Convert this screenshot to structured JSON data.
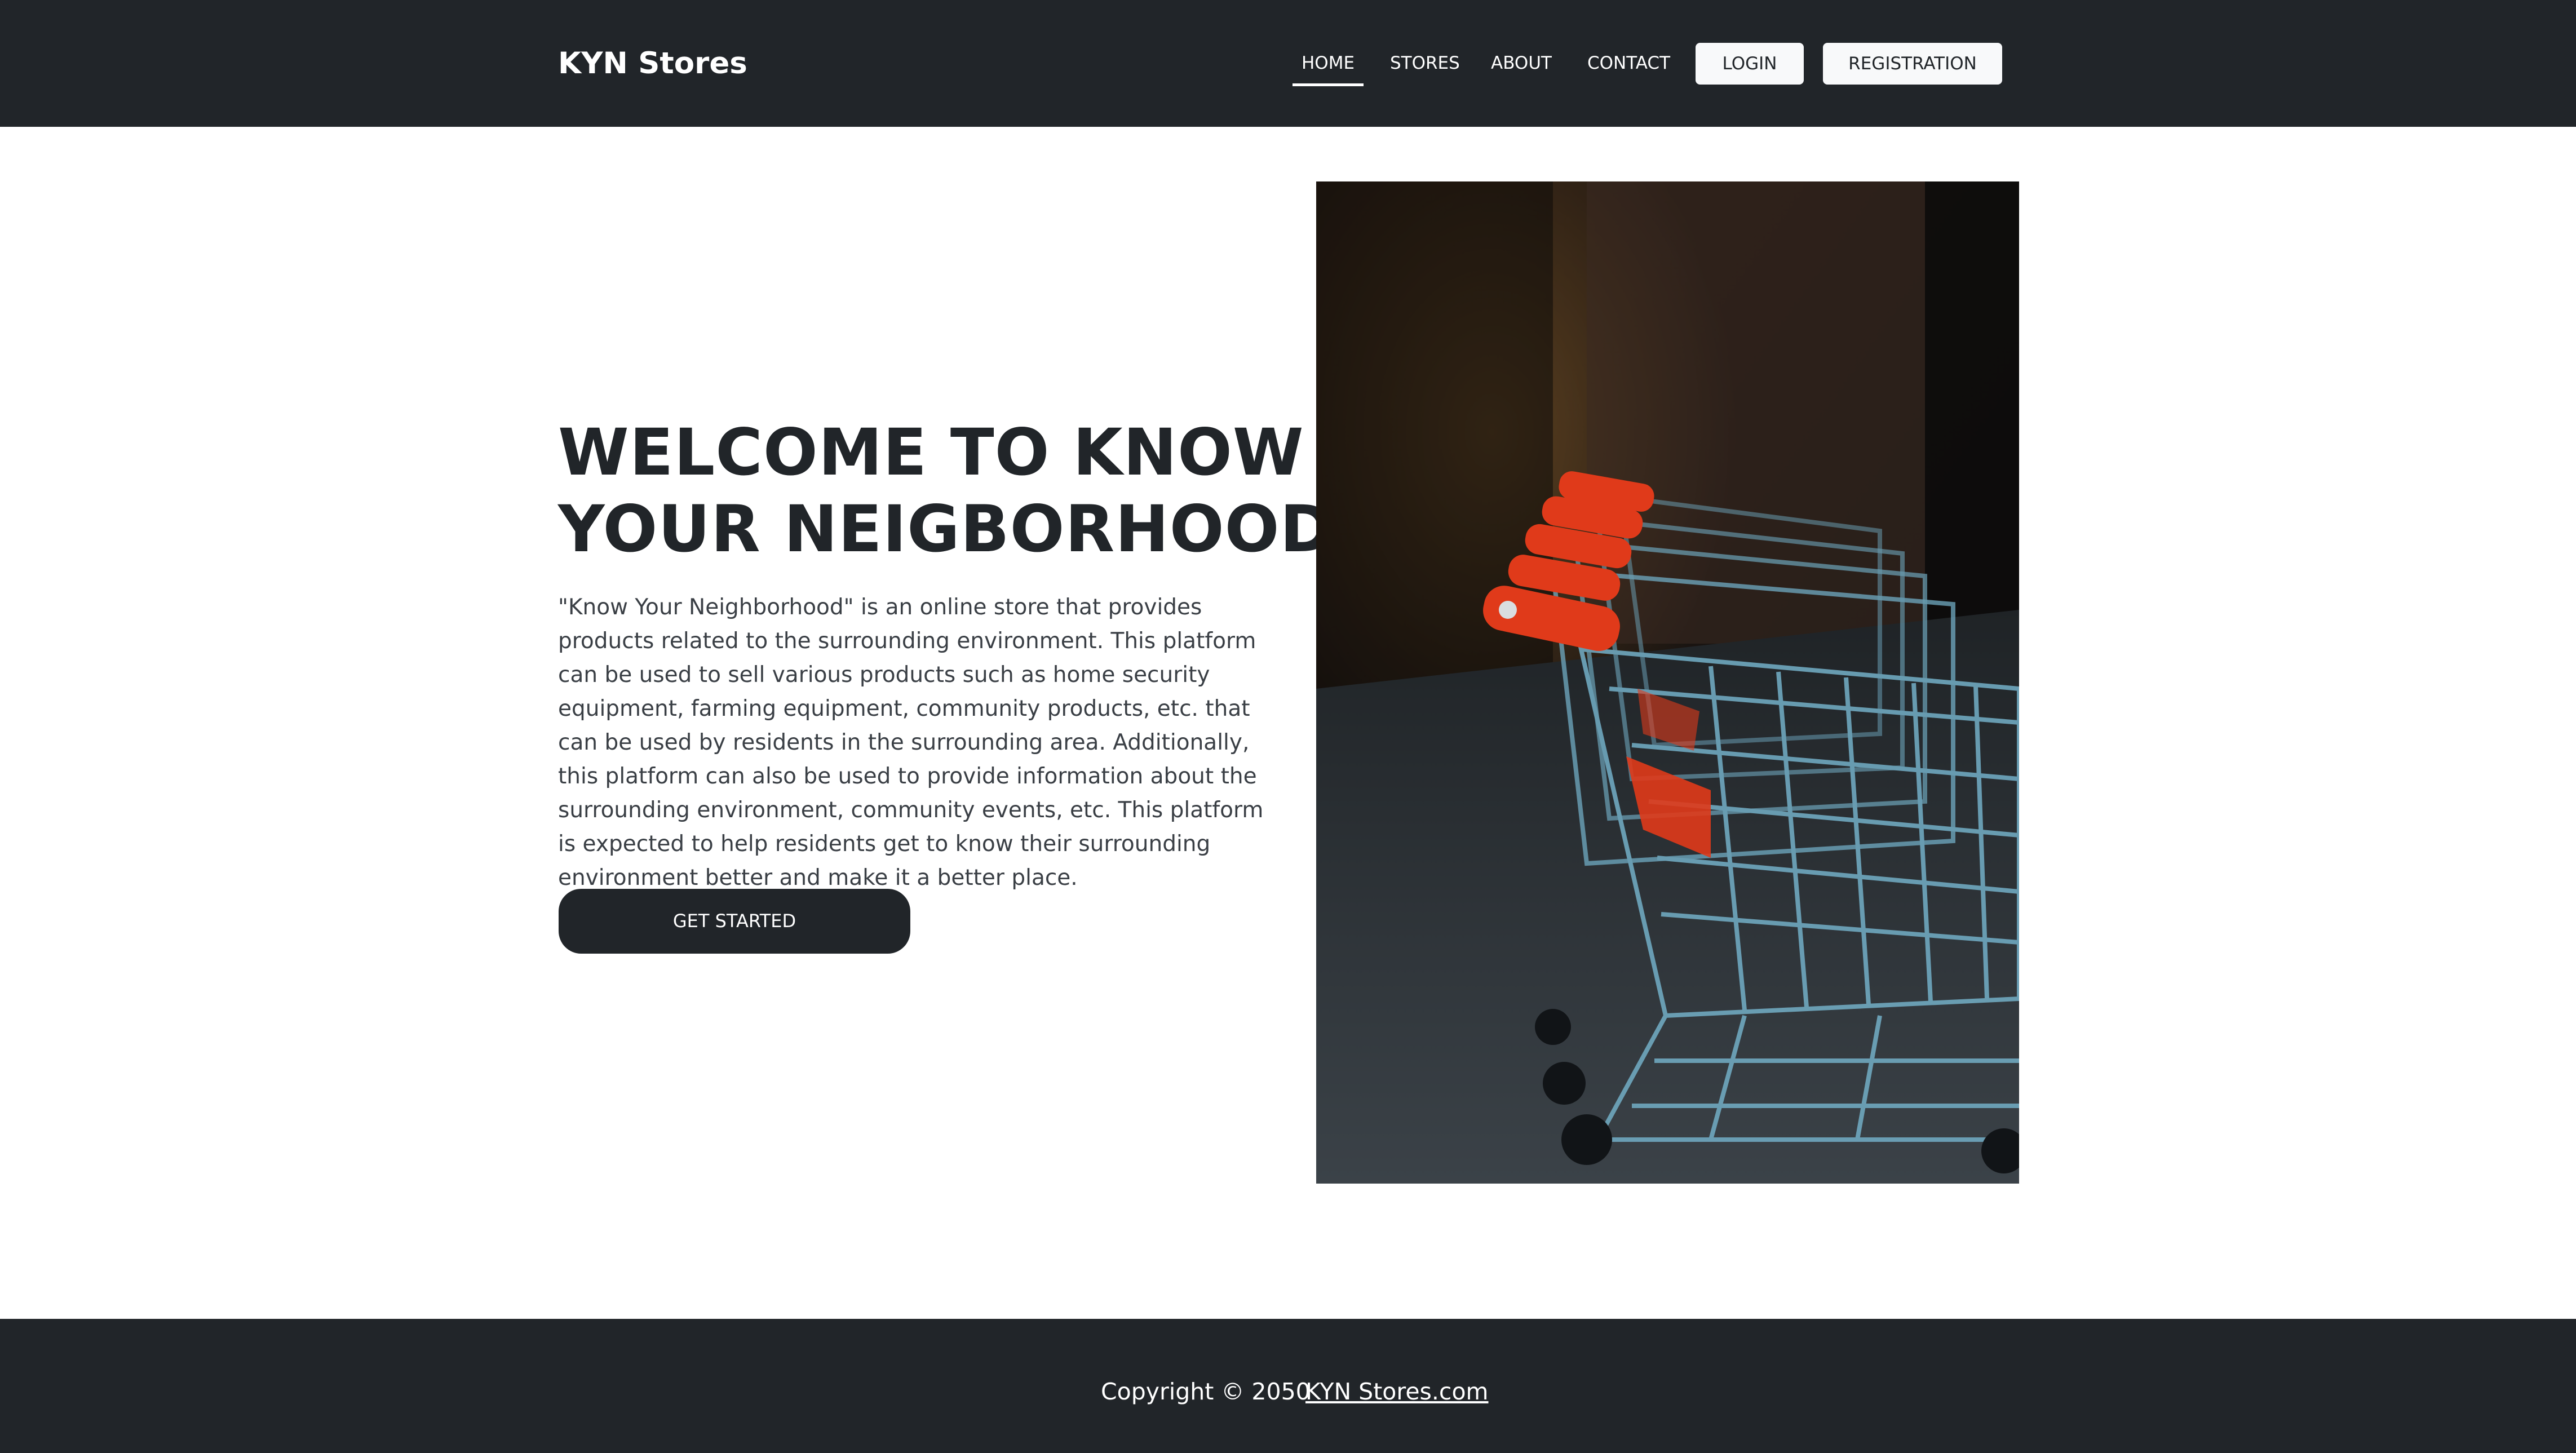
{
  "header": {
    "brand": "KYN Stores",
    "nav": {
      "home": "HOME",
      "stores": "STORES",
      "about": "ABOUT",
      "contact": "CONTACT"
    },
    "login_label": "LOGIN",
    "registration_label": "REGISTRATION"
  },
  "hero": {
    "title_line1": "WELCOME TO KNOW",
    "title_line2": "YOUR NEIGBORHOOD",
    "description": "\"Know Your Neighborhood\" is an online store that provides products related to the surrounding environment. This platform can be used to sell various products such as home security equipment, farming equipment, community products, etc. that can be used by residents in the surrounding area. Additionally, this platform can also be used to provide information about the surrounding environment, community events, etc. This platform is expected to help residents get to know their surrounding environment better and make it a better place.",
    "cta_label": "GET STARTED",
    "image_icon": "shopping-carts-photo"
  },
  "footer": {
    "copyright": "Copyright © 2050",
    "link_text": "KYN Stores.com"
  },
  "colors": {
    "dark": "#212529",
    "light_button": "#f8f9fa",
    "text": "#212529"
  }
}
